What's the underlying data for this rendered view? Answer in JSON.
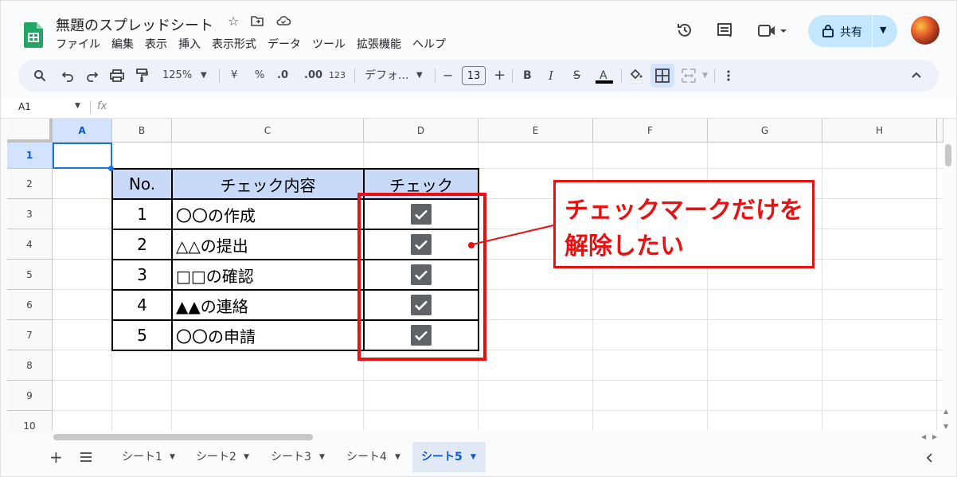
{
  "app": {
    "doc_title": "無題のスプレッドシート",
    "menu": [
      "ファイル",
      "編集",
      "表示",
      "挿入",
      "表示形式",
      "データ",
      "ツール",
      "拡張機能",
      "ヘルプ"
    ],
    "share_label": "共有"
  },
  "toolbar": {
    "zoom": "125%",
    "currency": "¥",
    "percent": "%",
    "dec_decrease": ".0",
    "dec_increase": ".00",
    "format_123": "123",
    "font": "デフォ...",
    "minus": "−",
    "font_size": "13",
    "plus": "+",
    "bold": "B",
    "italic": "I",
    "strike": "S",
    "text_color": "A"
  },
  "formula_bar": {
    "cell_ref": "A1",
    "fx": "fx"
  },
  "columns": [
    "A",
    "B",
    "C",
    "D",
    "E",
    "F",
    "G",
    "H"
  ],
  "rows": [
    "1",
    "2",
    "3",
    "4",
    "5",
    "6",
    "7",
    "8",
    "9",
    "10"
  ],
  "table": {
    "headers": [
      "No.",
      "チェック内容",
      "チェック"
    ],
    "rows": [
      {
        "no": "1",
        "item": "〇〇の作成",
        "checked": true
      },
      {
        "no": "2",
        "item": "△△の提出",
        "checked": true
      },
      {
        "no": "3",
        "item": "□□の確認",
        "checked": true
      },
      {
        "no": "4",
        "item": "▲▲の連絡",
        "checked": true
      },
      {
        "no": "5",
        "item": "〇〇の申請",
        "checked": true
      }
    ]
  },
  "callout": {
    "line1": "チェックマークだけを",
    "line2": "解除したい"
  },
  "sheets": [
    "シート1",
    "シート2",
    "シート3",
    "シート4",
    "シート5"
  ],
  "active_sheet": "シート5",
  "colors": {
    "accent_red": "#e81010",
    "header_fill": "#c9daf8",
    "selection": "#1a73e8",
    "share_bg": "#c2e7ff"
  }
}
